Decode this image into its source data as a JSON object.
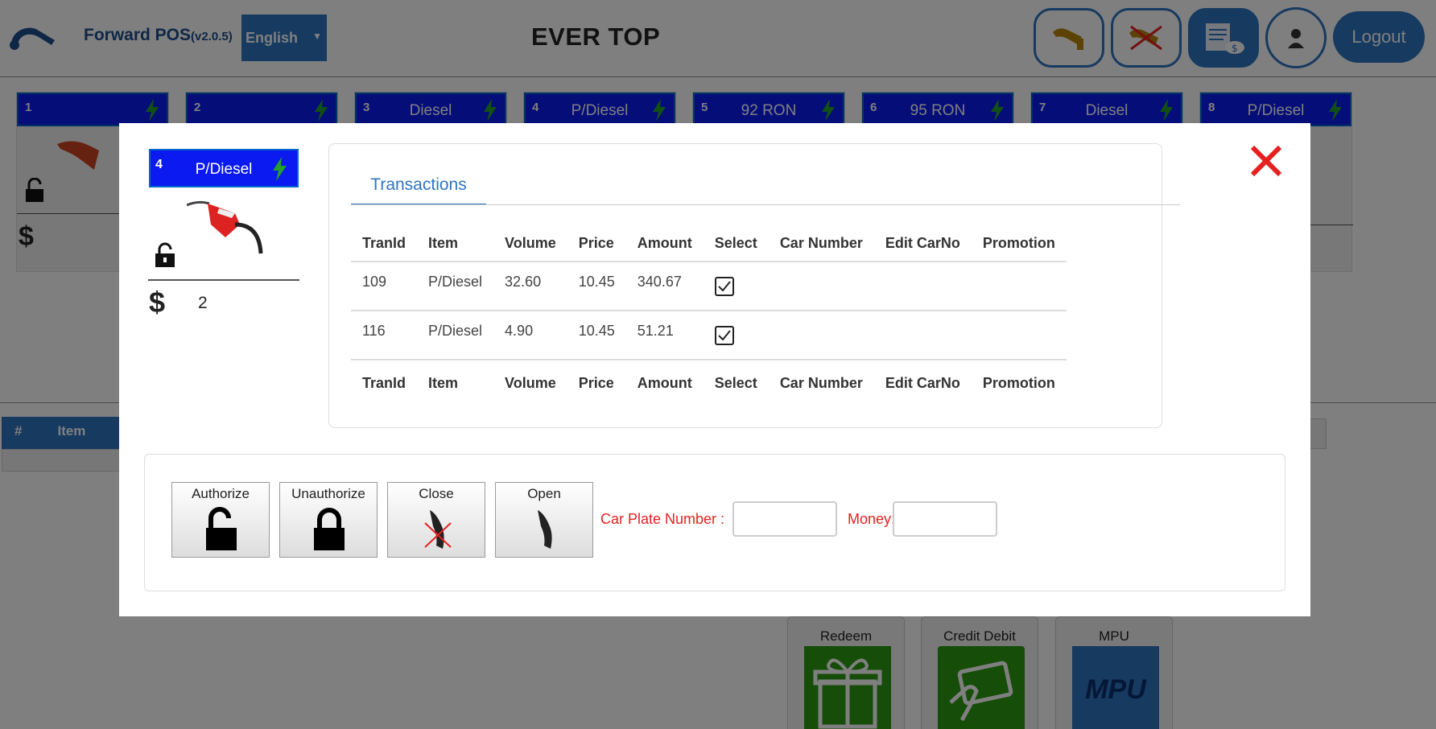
{
  "app": {
    "name": "Forward POS",
    "version": "(v2.0.5)",
    "language": "English",
    "station": "EVER TOP",
    "logout_label": "Logout"
  },
  "pumps": [
    {
      "num": "1",
      "fuel": ""
    },
    {
      "num": "2",
      "fuel": ""
    },
    {
      "num": "3",
      "fuel": "Diesel"
    },
    {
      "num": "4",
      "fuel": "P/Diesel"
    },
    {
      "num": "5",
      "fuel": "92 RON"
    },
    {
      "num": "6",
      "fuel": "95 RON"
    },
    {
      "num": "7",
      "fuel": "Diesel"
    },
    {
      "num": "8",
      "fuel": "P/Diesel"
    }
  ],
  "background": {
    "dollar": "$",
    "list_headers": [
      "#",
      "Item"
    ],
    "payments": [
      "Redeem",
      "Credit Debit",
      "MPU"
    ],
    "mpu_logo_text": "MPU"
  },
  "modal": {
    "pump_num": "4",
    "pump_fuel": "P/Diesel",
    "dollar": "$",
    "amount": "2",
    "tab_label": "Transactions",
    "columns": [
      "TranId",
      "Item",
      "Volume",
      "Price",
      "Amount",
      "Select",
      "Car Number",
      "Edit CarNo",
      "Promotion"
    ],
    "rows": [
      {
        "tranid": "109",
        "item": "P/Diesel",
        "volume": "32.60",
        "price": "10.45",
        "amount": "340.67",
        "selected": true,
        "car_number": "",
        "edit_carno": "",
        "promotion": ""
      },
      {
        "tranid": "116",
        "item": "P/Diesel",
        "volume": "4.90",
        "price": "10.45",
        "amount": "51.21",
        "selected": true,
        "car_number": "",
        "edit_carno": "",
        "promotion": ""
      }
    ],
    "buttons": {
      "authorize": "Authorize",
      "unauthorize": "Unauthorize",
      "close": "Close",
      "open": "Open"
    },
    "car_plate_label": "Car Plate Number :",
    "money_label": "Money:",
    "car_plate_value": "",
    "money_value": ""
  },
  "colors": {
    "primary": "#2f74c0",
    "pump_header": "#0a1af0",
    "bolt": "#22a02a",
    "alert_red": "#e62020",
    "payment_green": "#2a9a12"
  }
}
